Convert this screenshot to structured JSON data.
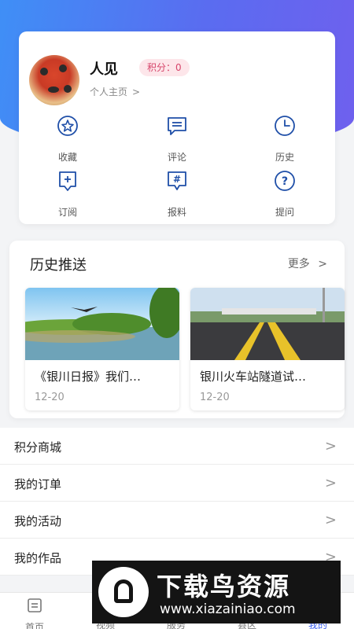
{
  "profile": {
    "name": "人见",
    "points_badge": "积分：0",
    "home_link": "个人主页"
  },
  "quick_actions": [
    {
      "label": "收藏",
      "icon": "star-icon"
    },
    {
      "label": "评论",
      "icon": "comment-icon"
    },
    {
      "label": "历史",
      "icon": "clock-icon"
    },
    {
      "label": "订阅",
      "icon": "bookmark-plus-icon"
    },
    {
      "label": "报料",
      "icon": "hashtag-message-icon"
    },
    {
      "label": "提问",
      "icon": "question-icon"
    }
  ],
  "history": {
    "title": "历史推送",
    "more_label": "更多",
    "items": [
      {
        "title": "《银川日报》我们…",
        "date": "12-20"
      },
      {
        "title": "银川火车站隧道试…",
        "date": "12-20"
      }
    ]
  },
  "menu": [
    {
      "label": "积分商城"
    },
    {
      "label": "我的订单"
    },
    {
      "label": "我的活动"
    },
    {
      "label": "我的作品"
    }
  ],
  "tabbar": [
    {
      "label": "首页"
    },
    {
      "label": "视频"
    },
    {
      "label": "服务"
    },
    {
      "label": "县区"
    },
    {
      "label": "我的"
    }
  ],
  "watermark": {
    "title": "下载鸟资源",
    "url": "www.xiazainiao.com"
  },
  "colors": {
    "accent": "#3a5ef0",
    "header_gradient_start": "#3f8ff6",
    "header_gradient_end": "#6f60ee",
    "badge_bg": "#fde6ea",
    "badge_text": "#d6456b"
  }
}
